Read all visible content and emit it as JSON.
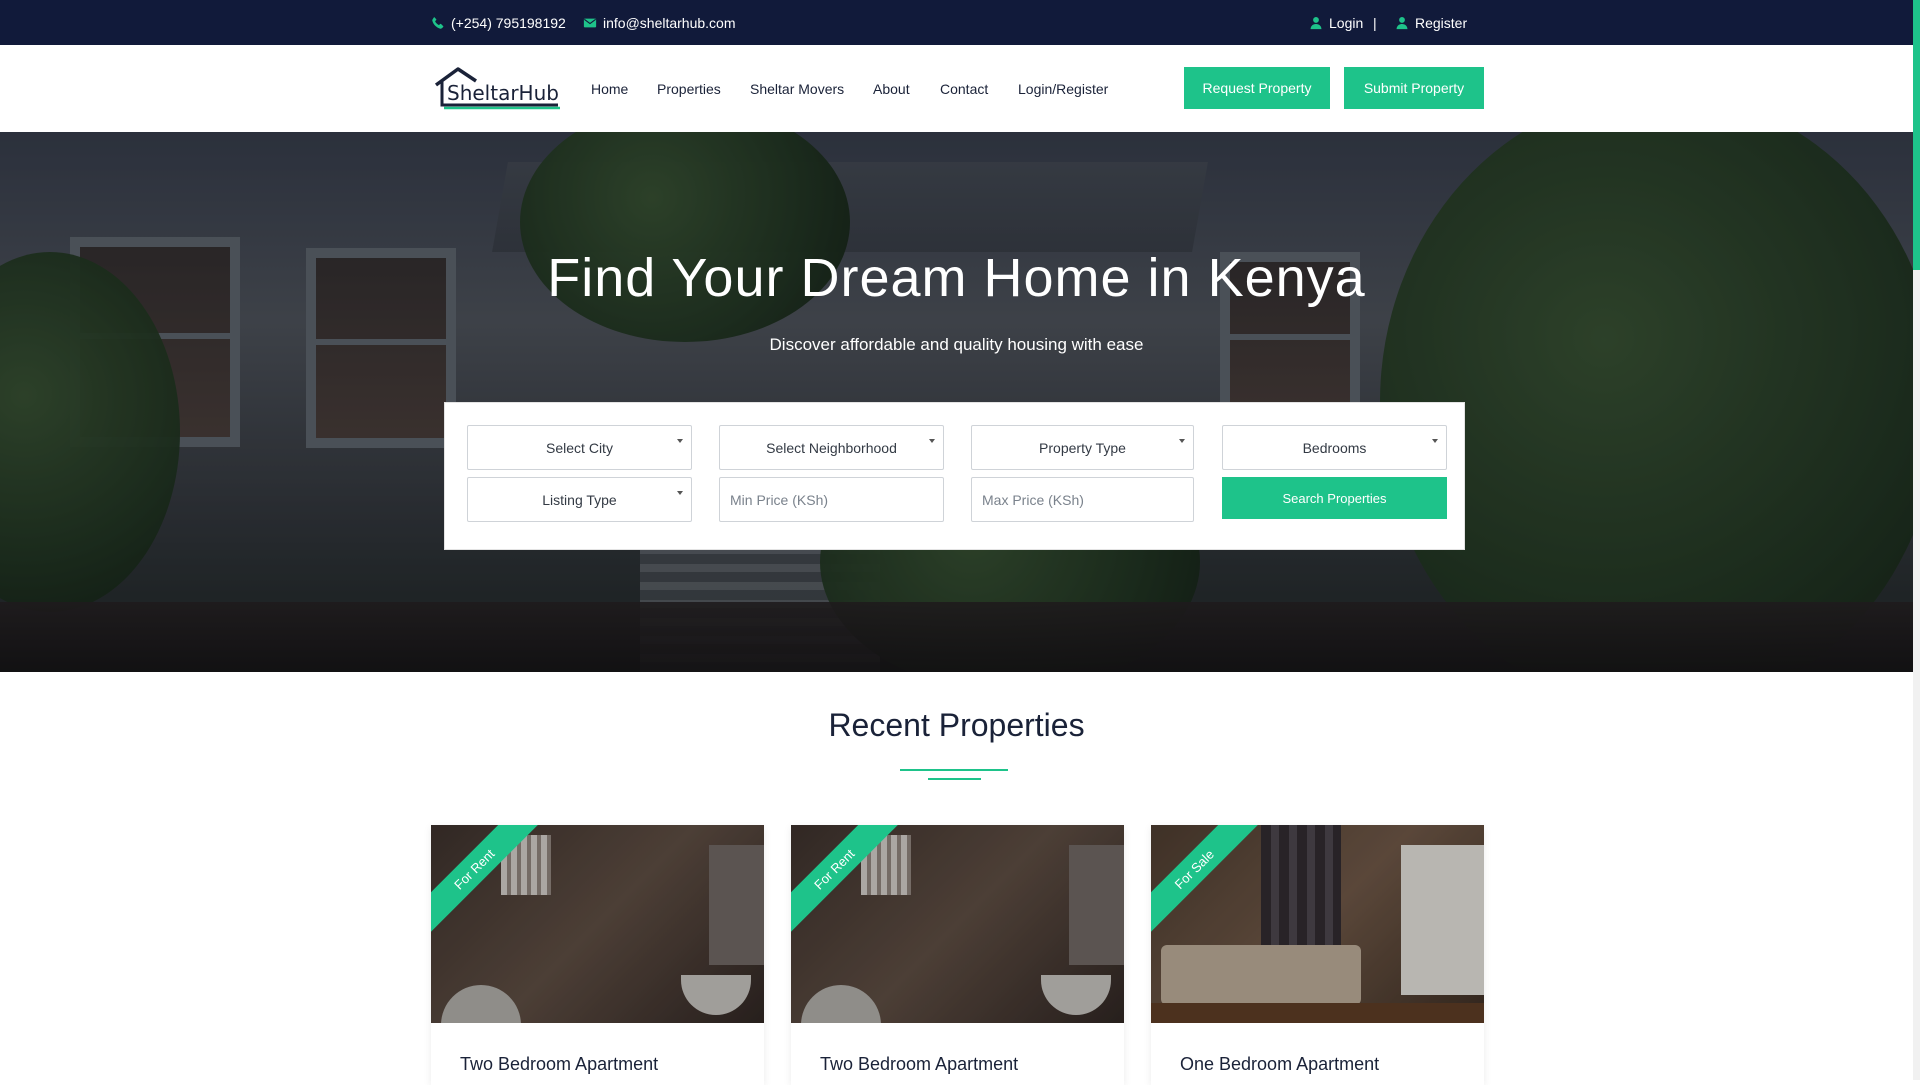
{
  "topbar": {
    "phone": "(+254) 795198192",
    "email": "info@sheltarhub.com",
    "login": "Login",
    "separator": "|",
    "register": "Register"
  },
  "nav": {
    "logo_text": "SheltarHub",
    "items": [
      "Home",
      "Properties",
      "Sheltar Movers",
      "About",
      "Contact",
      "Login/Register"
    ],
    "request_button": "Request Property",
    "submit_button": "Submit Property"
  },
  "hero": {
    "title": "Find Your Dream Home in Kenya",
    "subtitle": "Discover affordable and quality housing with ease"
  },
  "search": {
    "city": "Select City",
    "neighborhood": "Select Neighborhood",
    "property_type": "Property Type",
    "bedrooms": "Bedrooms",
    "listing_type": "Listing Type",
    "min_price_placeholder": "Min Price (KSh)",
    "max_price_placeholder": "Max Price (KSh)",
    "search_button": "Search Properties"
  },
  "recent": {
    "title": "Recent Properties",
    "cards": [
      {
        "badge": "For Rent",
        "title": "Two Bedroom Apartment"
      },
      {
        "badge": "For Rent",
        "title": "Two Bedroom Apartment"
      },
      {
        "badge": "For Sale",
        "title": "One Bedroom Apartment"
      }
    ]
  },
  "colors": {
    "accent": "#1ec38a",
    "topbar_bg": "#111a3a",
    "heading": "#1a2238"
  },
  "icons": {
    "phone": "phone-icon",
    "email": "envelope-icon",
    "user": "user-icon",
    "caret": "caret-down-icon"
  }
}
